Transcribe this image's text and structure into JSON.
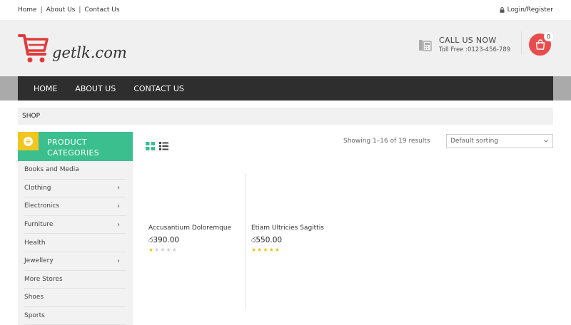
{
  "topbar": {
    "links": [
      "Home",
      "About Us",
      "Contact Us"
    ],
    "separator": "|",
    "login_label": "Login/Register"
  },
  "header": {
    "logo_text": "getlk.com",
    "call_title": "CALL US NOW",
    "call_sub": "Toll Free :0123-456-789",
    "cart_count": "0"
  },
  "nav": {
    "items": [
      "HOME",
      "ABOUT US",
      "CONTACT US"
    ]
  },
  "breadcrumb": "SHOP",
  "sidebar": {
    "title_line1": "PRODUCT",
    "title_line2": "CATEGORIES",
    "categories": [
      {
        "label": "Books and Media",
        "has_children": false
      },
      {
        "label": "Clothing",
        "has_children": true
      },
      {
        "label": "Electronics",
        "has_children": true
      },
      {
        "label": "Furniture",
        "has_children": true
      },
      {
        "label": "Health",
        "has_children": false
      },
      {
        "label": "Jewellery",
        "has_children": true
      },
      {
        "label": "More Stores",
        "has_children": false
      },
      {
        "label": "Shoes",
        "has_children": false
      },
      {
        "label": "Sports",
        "has_children": false
      }
    ],
    "chevron": "›"
  },
  "shop": {
    "result_count": "Showing 1–16 of 19 results",
    "sorting_selected": "Default sorting"
  },
  "products": [
    {
      "name": "Accusantium Doloremque",
      "price": "390.00",
      "rating": 1
    },
    {
      "name": "Etiam Ultricies Sagittis",
      "price": "550.00",
      "rating": 5
    }
  ],
  "colors": {
    "accent_green": "#3bbf8f",
    "accent_yellow": "#f1c61f",
    "cart_red": "#e84c4c",
    "nav_dark": "#2e2e2e"
  }
}
